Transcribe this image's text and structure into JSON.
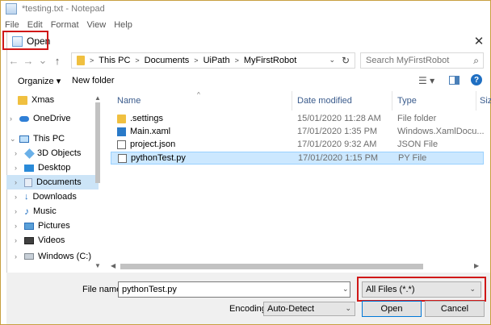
{
  "notepad": {
    "title": "*testing.txt - Notepad",
    "menu": [
      "File",
      "Edit",
      "Format",
      "View",
      "Help"
    ]
  },
  "dialog": {
    "title": "Open",
    "close_glyph": "✕",
    "nav": {
      "back": "←",
      "forward": "→",
      "recent": "⌄",
      "up": "↑"
    },
    "address": {
      "crumbs": [
        "This PC",
        "Documents",
        "UiPath",
        "MyFirstRobot"
      ],
      "separator": ">",
      "dropdown": "⌄",
      "refresh": "↻"
    },
    "search": {
      "placeholder": "Search MyFirstRobot",
      "icon": "⌕"
    },
    "toolbar": {
      "organize": "Organize ▾",
      "new_folder": "New folder",
      "view_glyph": "☰ ▾",
      "help_glyph": "?"
    },
    "sidebar": {
      "items": [
        {
          "label": "Xmas",
          "icon": "folder-icon",
          "selected": false
        },
        {
          "label": "OneDrive",
          "icon": "cloud-icon",
          "selected": false
        },
        {
          "label": "This PC",
          "icon": "computer-icon",
          "selected": false
        },
        {
          "label": "3D Objects",
          "icon": "cube-icon",
          "selected": false
        },
        {
          "label": "Desktop",
          "icon": "desktop-icon",
          "selected": false
        },
        {
          "label": "Documents",
          "icon": "documents-icon",
          "selected": true
        },
        {
          "label": "Downloads",
          "icon": "download-icon",
          "selected": false
        },
        {
          "label": "Music",
          "icon": "music-icon",
          "selected": false
        },
        {
          "label": "Pictures",
          "icon": "pictures-icon",
          "selected": false
        },
        {
          "label": "Videos",
          "icon": "videos-icon",
          "selected": false
        },
        {
          "label": "Windows (C:)",
          "icon": "drive-icon",
          "selected": false
        }
      ]
    },
    "columns": {
      "name": "Name",
      "date": "Date modified",
      "type": "Type",
      "size": "Siz"
    },
    "files": [
      {
        "name": ".settings",
        "date": "15/01/2020 11:28 AM",
        "type": "File folder",
        "icon": "folder-icon",
        "selected": false
      },
      {
        "name": "Main.xaml",
        "date": "17/01/2020 1:35 PM",
        "type": "Windows.XamlDocu...",
        "icon": "xaml-file-icon",
        "selected": false
      },
      {
        "name": "project.json",
        "date": "17/01/2020 9:32 AM",
        "type": "JSON File",
        "icon": "json-file-icon",
        "selected": false
      },
      {
        "name": "pythonTest.py",
        "date": "17/01/2020 1:15 PM",
        "type": "PY File",
        "icon": "py-file-icon",
        "selected": true
      }
    ],
    "footer": {
      "file_name_label": "File name:",
      "file_name_value": "pythonTest.py",
      "filter_value": "All Files  (*.*)",
      "encoding_label": "Encoding:",
      "encoding_value": "Auto-Detect",
      "open_button": "Open",
      "cancel_button": "Cancel"
    }
  },
  "colors": {
    "annotation_red": "#d01818",
    "selection_blue": "#cce8ff",
    "accent": "#0078d7"
  }
}
